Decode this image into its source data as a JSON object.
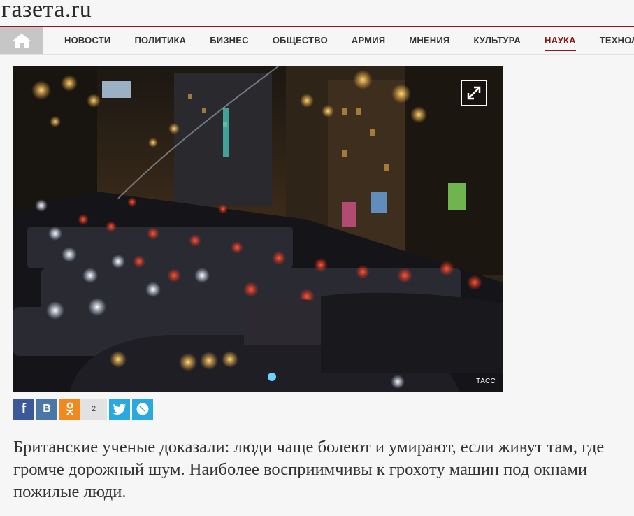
{
  "site": {
    "logo": "газета.ru"
  },
  "nav": {
    "home_icon": "home-icon",
    "items": [
      {
        "label": "НОВОСТИ"
      },
      {
        "label": "ПОЛИТИКА"
      },
      {
        "label": "БИЗНЕС"
      },
      {
        "label": "ОБЩЕСТВО"
      },
      {
        "label": "АРМИЯ"
      },
      {
        "label": "МНЕНИЯ"
      },
      {
        "label": "КУЛЬТУРА"
      },
      {
        "label": "НАУКА",
        "active": true
      },
      {
        "label": "ТЕХНОЛОГИИ"
      }
    ]
  },
  "article": {
    "photo_credit": "ТАСС",
    "expand_icon": "expand-icon",
    "lead": "Британские ученые доказали: люди чаще болеют и умирают, если живут там, где громче дорожный шум. Наиболее восприимчивы к грохоту машин под окнами пожилые люди."
  },
  "share": {
    "facebook": "f",
    "vkontakte": "В",
    "odnoklassniki_count": "2",
    "twitter_icon": "twitter-icon",
    "livejournal_icon": "livejournal-icon"
  },
  "colors": {
    "accent": "#8b1a1a",
    "facebook": "#3b5998",
    "vkontakte": "#4a76a8",
    "odnoklassniki": "#f08a1e",
    "twitter": "#2aa9e0"
  }
}
